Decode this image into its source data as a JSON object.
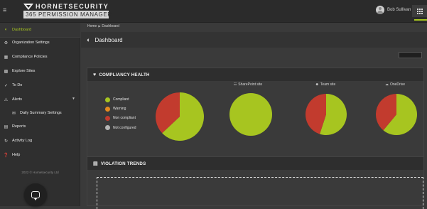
{
  "topbar": {
    "brand_name": "HORNETSECURITY",
    "product_name": "365 PERMISSION MANAGER",
    "user_name": "Bob Sullivan"
  },
  "sidebar": {
    "items": [
      {
        "label": "Dashboard",
        "icon": "dashboard-icon"
      },
      {
        "label": "Organization Settings",
        "icon": "gear-icon"
      },
      {
        "label": "Compliance Policies",
        "icon": "policy-icon"
      },
      {
        "label": "Explore Sites",
        "icon": "explore-icon"
      },
      {
        "label": "To Do",
        "icon": "check-icon"
      },
      {
        "label": "Alerts",
        "icon": "alert-icon"
      },
      {
        "label": "Daily Summary Settings",
        "icon": "mail-icon"
      },
      {
        "label": "Reports",
        "icon": "reports-icon"
      },
      {
        "label": "Activity Log",
        "icon": "history-icon"
      },
      {
        "label": "Help",
        "icon": "help-icon"
      }
    ],
    "copyright": "2022 © Hornetsecurity Ltd"
  },
  "breadcrumb": {
    "home": "Home",
    "current": "Dashboard"
  },
  "page": {
    "title": "Dashboard"
  },
  "compliancy": {
    "title": "COMPLIANCY HEALTH",
    "legend": [
      {
        "label": "Compliant",
        "color": "#a7c520"
      },
      {
        "label": "Warning",
        "color": "#e58a1f"
      },
      {
        "label": "Non compliant",
        "color": "#c23b2e"
      },
      {
        "label": "Not configured",
        "color": "#b5b5b5"
      }
    ],
    "charts": [
      {
        "label": "",
        "compliant": 0.63,
        "noncompliant": 0.37
      },
      {
        "label": "SharePoint site",
        "icon": "sitemap-icon",
        "compliant": 1.0,
        "noncompliant": 0.0
      },
      {
        "label": "Team site",
        "icon": "team-icon",
        "compliant": 0.55,
        "noncompliant": 0.45
      },
      {
        "label": "OneDrive",
        "icon": "cloud-icon",
        "compliant": 0.61,
        "noncompliant": 0.39
      }
    ]
  },
  "trends": {
    "title": "VIOLATION TRENDS"
  },
  "colors": {
    "accent": "#a7c520",
    "compliant": "#a7c520",
    "noncompliant": "#c23b2e"
  }
}
